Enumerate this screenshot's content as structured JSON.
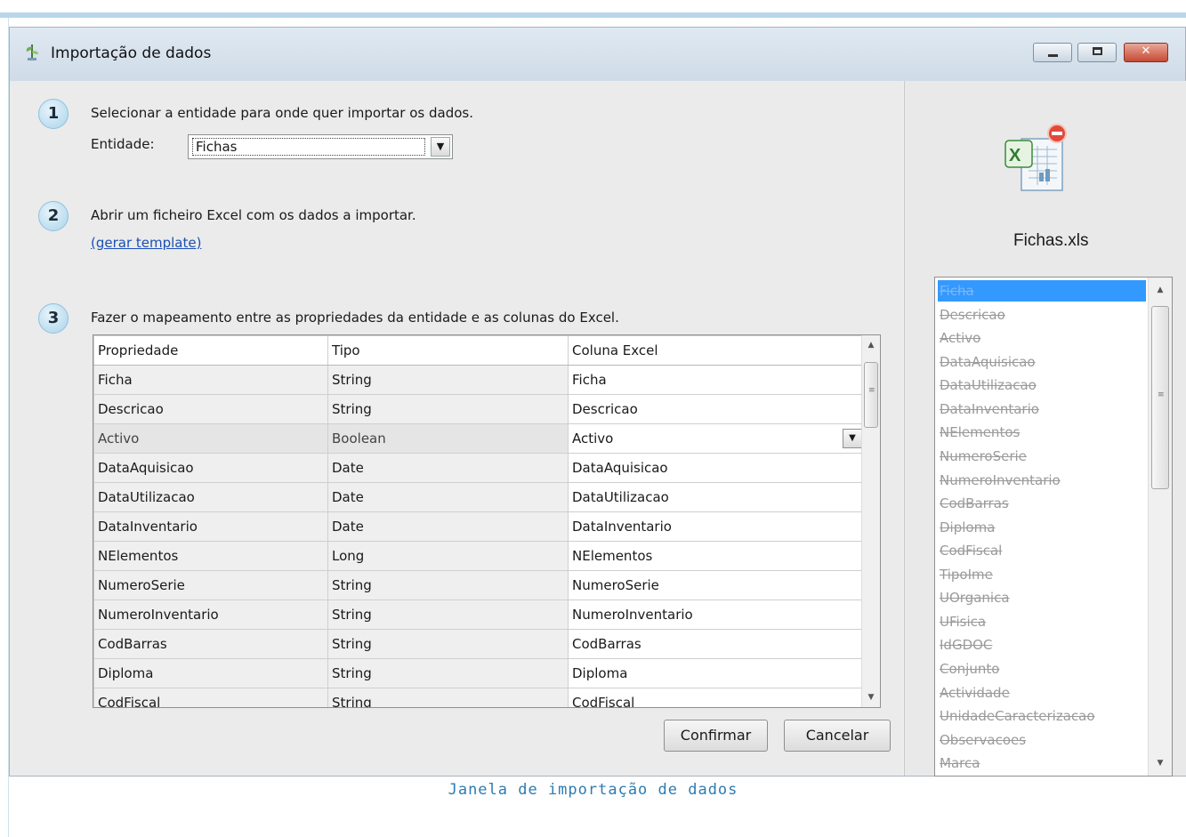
{
  "window": {
    "title": "Importação de dados",
    "buttons": {
      "minimize": "—",
      "maximize": "□",
      "close": "✕"
    }
  },
  "steps": [
    {
      "number": "1",
      "text": "Selecionar a entidade para onde quer importar os dados."
    },
    {
      "number": "2",
      "text": "Abrir um ficheiro Excel com os dados a importar."
    },
    {
      "number": "3",
      "text": "Fazer o mapeamento entre as propriedades da entidade e as colunas do Excel."
    }
  ],
  "entity": {
    "label": "Entidade:",
    "selected": "Fichas"
  },
  "template_link": "(gerar template)",
  "mapping": {
    "columns": [
      "Propriedade",
      "Tipo",
      "Coluna Excel"
    ],
    "rows": [
      [
        "Ficha",
        "String",
        "Ficha"
      ],
      [
        "Descricao",
        "String",
        "Descricao"
      ],
      [
        "Activo",
        "Boolean",
        "Activo"
      ],
      [
        "DataAquisicao",
        "Date",
        "DataAquisicao"
      ],
      [
        "DataUtilizacao",
        "Date",
        "DataUtilizacao"
      ],
      [
        "DataInventario",
        "Date",
        "DataInventario"
      ],
      [
        "NElementos",
        "Long",
        "NElementos"
      ],
      [
        "NumeroSerie",
        "String",
        "NumeroSerie"
      ],
      [
        "NumeroInventario",
        "String",
        "NumeroInventario"
      ],
      [
        "CodBarras",
        "String",
        "CodBarras"
      ],
      [
        "Diploma",
        "String",
        "Diploma"
      ],
      [
        "CodFiscal",
        "String",
        "CodFiscal"
      ]
    ]
  },
  "buttons": {
    "confirm": "Confirmar",
    "cancel": "Cancelar"
  },
  "file": {
    "name": "Fichas.xls",
    "icon": "excel-file-icon"
  },
  "excel_columns": [
    "Ficha",
    "Descricao",
    "Activo",
    "DataAquisicao",
    "DataUtilizacao",
    "DataInventario",
    "NElementos",
    "NumeroSerie",
    "NumeroInventario",
    "CodBarras",
    "Diploma",
    "CodFiscal",
    "TipoIme",
    "UOrganica",
    "UFisica",
    "IdGDOC",
    "Conjunto",
    "Actividade",
    "UnidadeCaracterizacao",
    "Observacoes",
    "Marca"
  ],
  "caption": "Janela de importação de dados",
  "colors": {
    "accent": "#3399ff",
    "link": "#1a4fb5",
    "caption": "#2d7bb3"
  }
}
